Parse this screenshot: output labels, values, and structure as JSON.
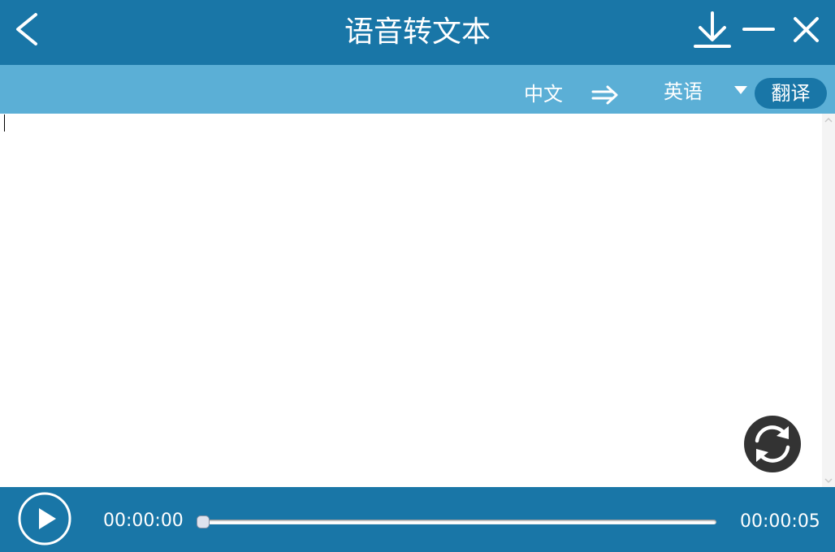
{
  "title_bar": {
    "title": "语音转文本",
    "back_icon": "chevron-left-icon",
    "download_icon": "download-icon",
    "minimize_icon": "minimize-icon",
    "close_icon": "close-icon"
  },
  "language_bar": {
    "source_language": "中文",
    "arrow_icon": "arrow-right-icon",
    "target_language": "英语",
    "dropdown_icon": "caret-down-icon",
    "translate_label": "翻译"
  },
  "editor": {
    "text": "",
    "refresh_icon": "refresh-icon"
  },
  "player": {
    "play_icon": "play-icon",
    "current_time": "00:00:00",
    "total_time": "00:00:05",
    "progress": 0
  },
  "colors": {
    "primary": "#1976a7",
    "secondary": "#5bafd6",
    "background": "#ffffff"
  }
}
